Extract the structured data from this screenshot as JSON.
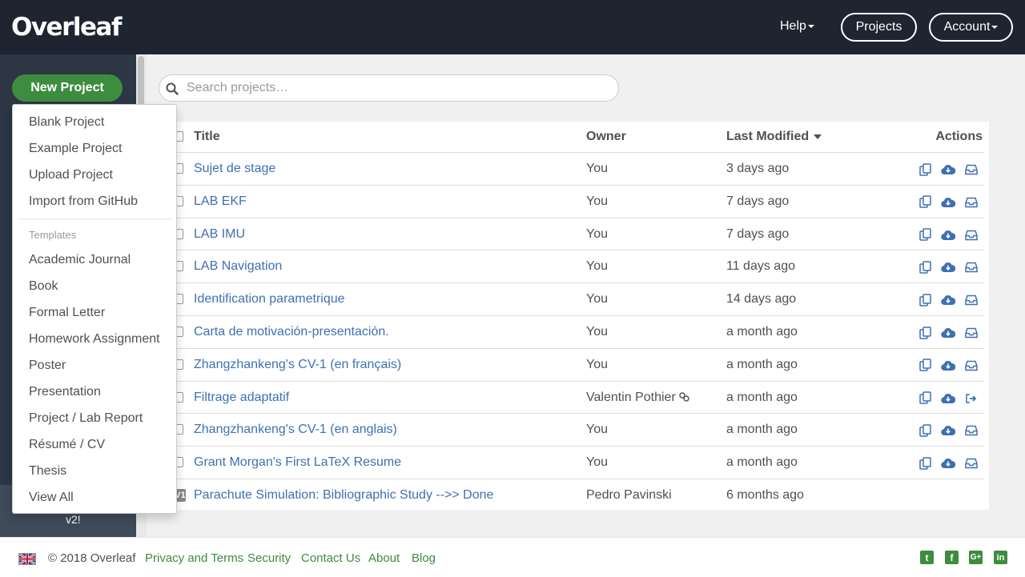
{
  "brand": {
    "name": "Overleaf"
  },
  "nav": {
    "help": "Help",
    "projects": "Projects",
    "account": "Account"
  },
  "sidebar": {
    "new_project": "New Project",
    "version_note": "v2!",
    "menu": {
      "items": [
        "Blank Project",
        "Example Project",
        "Upload Project",
        "Import from GitHub"
      ],
      "templates_header": "Templates",
      "templates": [
        "Academic Journal",
        "Book",
        "Formal Letter",
        "Homework Assignment",
        "Poster",
        "Presentation",
        "Project / Lab Report",
        "Résumé / CV",
        "Thesis",
        "View All"
      ]
    }
  },
  "search": {
    "placeholder": "Search projects…",
    "value": ""
  },
  "table": {
    "headers": {
      "title": "Title",
      "owner": "Owner",
      "last_modified": "Last Modified",
      "actions": "Actions"
    },
    "rows": [
      {
        "title": "Sujet de stage",
        "owner": "You",
        "modified": "3 days ago"
      },
      {
        "title": "LAB EKF",
        "owner": "You",
        "modified": "7 days ago"
      },
      {
        "title": "LAB IMU",
        "owner": "You",
        "modified": "7 days ago"
      },
      {
        "title": "LAB Navigation",
        "owner": "You",
        "modified": "11 days ago"
      },
      {
        "title": "Identification parametrique",
        "owner": "You",
        "modified": "14 days ago"
      },
      {
        "title": "Carta de motivación-presentación.",
        "owner": "You",
        "modified": "a month ago"
      },
      {
        "title": "Zhangzhankeng's CV-1 (en français)",
        "owner": "You",
        "modified": "a month ago"
      },
      {
        "title": "Filtrage adaptatif",
        "owner": "Valentin Pothier",
        "modified": "a month ago"
      },
      {
        "title": "Zhangzhankeng's CV-1 (en anglais)",
        "owner": "You",
        "modified": "a month ago"
      },
      {
        "title": "Grant Morgan's First LaTeX Resume",
        "owner": "You",
        "modified": "a month ago"
      },
      {
        "title": "Parachute Simulation: Bibliographic Study -->> Done",
        "owner": "Pedro Pavinski",
        "modified": "6 months ago",
        "badge": "V1"
      }
    ]
  },
  "footer": {
    "copyright": "© 2018 Overleaf",
    "links": [
      "Privacy and Terms",
      "Security",
      "Contact Us",
      "About",
      "Blog"
    ]
  },
  "colors": {
    "brand_green": "#3d8c40",
    "link_blue": "#3e70b2",
    "nav_dark": "#1e2530"
  }
}
